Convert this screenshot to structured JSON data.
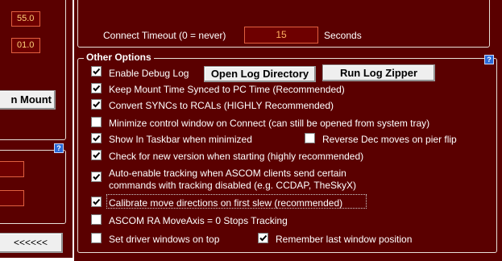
{
  "left_panel": {
    "field_1": "55.0",
    "field_2": "01.0",
    "mount_button": "n Mount",
    "back_button": "<<<<<<"
  },
  "connect": {
    "label": "Connect Timeout (0 = never)",
    "value": "15",
    "unit": "Seconds"
  },
  "other_options": {
    "title": "Other Options",
    "help": "?",
    "open_log_button": "Open Log Directory",
    "run_zipper_button": "Run Log Zipper",
    "options": [
      {
        "label": "Enable Debug Log",
        "checked": true
      },
      {
        "label": "Keep Mount Time Synced to PC Time (Recommended)",
        "checked": true
      },
      {
        "label": "Convert SYNCs to RCALs (HIGHLY Recommended)",
        "checked": true
      },
      {
        "label": "Minimize control window on Connect (can still be opened from system tray)",
        "checked": false
      },
      {
        "label": "Show In Taskbar when minimized",
        "checked": true
      },
      {
        "label": "Reverse Dec moves on pier flip",
        "checked": false
      },
      {
        "label": "Check for new version when starting (highly recommended)",
        "checked": true
      },
      {
        "label": "Auto-enable tracking when ASCOM clients send certain commands with tracking disabled (e.g. CCDAP, TheSkyX)",
        "checked": true
      },
      {
        "label": "Calibrate move directions on first slew (recommended)",
        "checked": true
      },
      {
        "label": "ASCOM RA MoveAxis = 0 Stops Tracking",
        "checked": false
      },
      {
        "label": "Set driver windows on top",
        "checked": false
      },
      {
        "label": "Remember last window position",
        "checked": true
      }
    ]
  },
  "left_help": "?",
  "colors": {
    "panel_bg": "#5a0000",
    "field_bg": "#6e0000",
    "field_text": "#ffd27a",
    "help_blue": "#2a6ad8"
  }
}
